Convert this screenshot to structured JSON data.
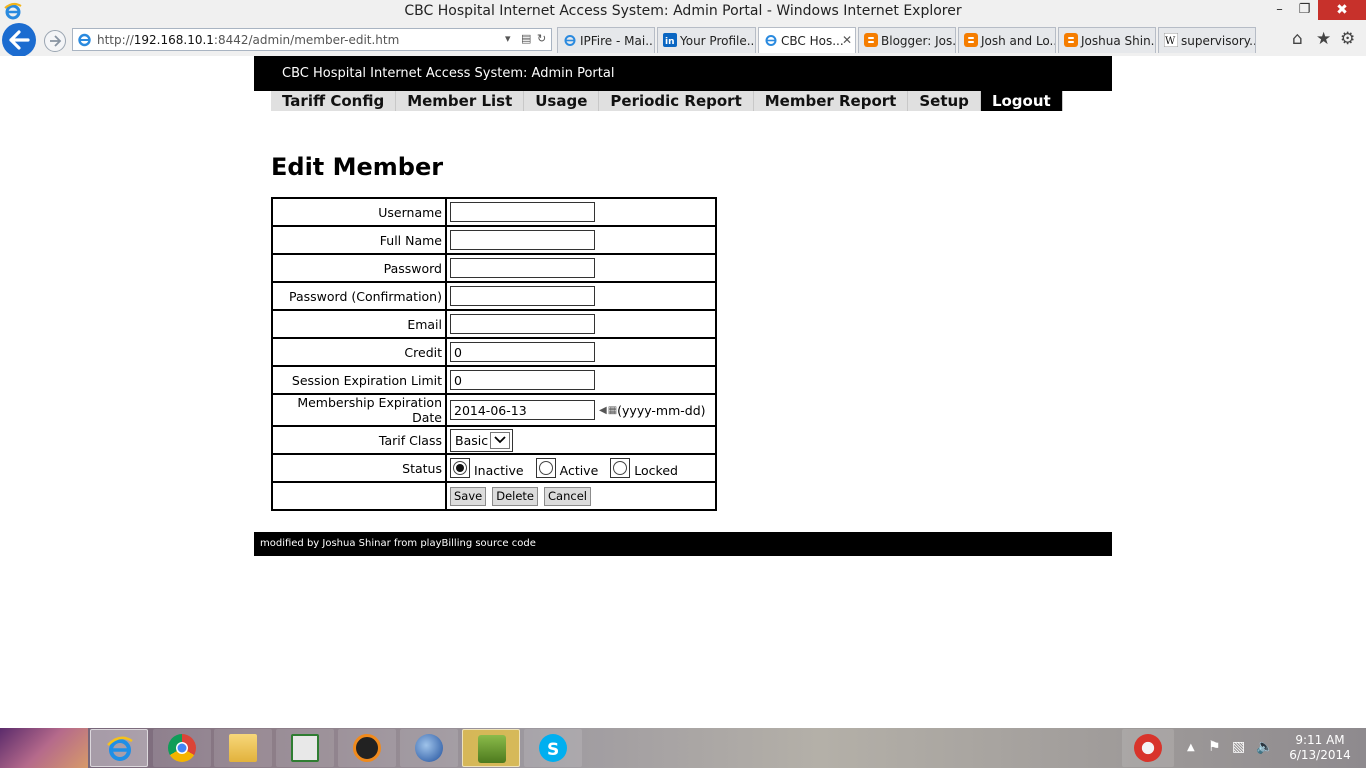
{
  "window": {
    "title": "CBC Hospital Internet Access System: Admin Portal - Windows Internet Explorer",
    "minimize_glyph": "–",
    "restore_glyph": "❐",
    "close_glyph": "✖"
  },
  "browser": {
    "url_prefix": "http://",
    "url_host": "192.168.10.1",
    "url_rest": ":8442/admin/member-edit.htm",
    "tabs": [
      {
        "label": "IPFire - Mai...",
        "icon": "ie-icon",
        "active": false
      },
      {
        "label": "Your Profile...",
        "icon": "linkedin-icon",
        "active": false
      },
      {
        "label": "CBC Hos...",
        "icon": "ie-icon",
        "active": true
      },
      {
        "label": "Blogger: Jos...",
        "icon": "blogger-icon",
        "active": false
      },
      {
        "label": "Josh and Lo...",
        "icon": "blogger-icon",
        "active": false
      },
      {
        "label": "Joshua Shin...",
        "icon": "blogger-icon",
        "active": false
      },
      {
        "label": "supervisory...",
        "icon": "wikipedia-icon",
        "active": false
      }
    ],
    "tab_close_glyph": "✕",
    "home_glyph": "⌂",
    "favorites_glyph": "★",
    "tools_glyph": "⚙"
  },
  "portal": {
    "header": "CBC Hospital Internet Access System: Admin Portal",
    "menu": [
      {
        "label": "Tariff Config",
        "name": "tariff-config"
      },
      {
        "label": "Member List",
        "name": "member-list"
      },
      {
        "label": "Usage",
        "name": "usage"
      },
      {
        "label": "Periodic Report",
        "name": "periodic-report"
      },
      {
        "label": "Member Report",
        "name": "member-report"
      },
      {
        "label": "Setup",
        "name": "setup"
      },
      {
        "label": "Logout",
        "name": "logout"
      }
    ],
    "page_title": "Edit Member",
    "fields": {
      "username": {
        "label": "Username",
        "value": ""
      },
      "full_name": {
        "label": "Full Name",
        "value": ""
      },
      "password": {
        "label": "Password",
        "value": ""
      },
      "password_confirm": {
        "label": "Password (Confirmation)",
        "value": ""
      },
      "email": {
        "label": "Email",
        "value": ""
      },
      "credit": {
        "label": "Credit",
        "value": "0"
      },
      "session_limit": {
        "label": "Session Expiration Limit",
        "value": "0"
      },
      "membership_expiration": {
        "label": "Membership Expiration Date",
        "value": "2014-06-13",
        "format_hint": "(yyyy-mm-dd)"
      },
      "tarif_class": {
        "label": "Tarif Class",
        "value": "Basic"
      },
      "status": {
        "label": "Status",
        "options": [
          "Inactive",
          "Active",
          "Locked"
        ],
        "selected": "Inactive"
      }
    },
    "buttons": {
      "save": "Save",
      "delete": "Delete",
      "cancel": "Cancel"
    },
    "footer": "modified by Joshua Shinar from playBilling source code"
  },
  "taskbar": {
    "clock_time": "9:11 AM",
    "clock_date": "6/13/2014"
  }
}
